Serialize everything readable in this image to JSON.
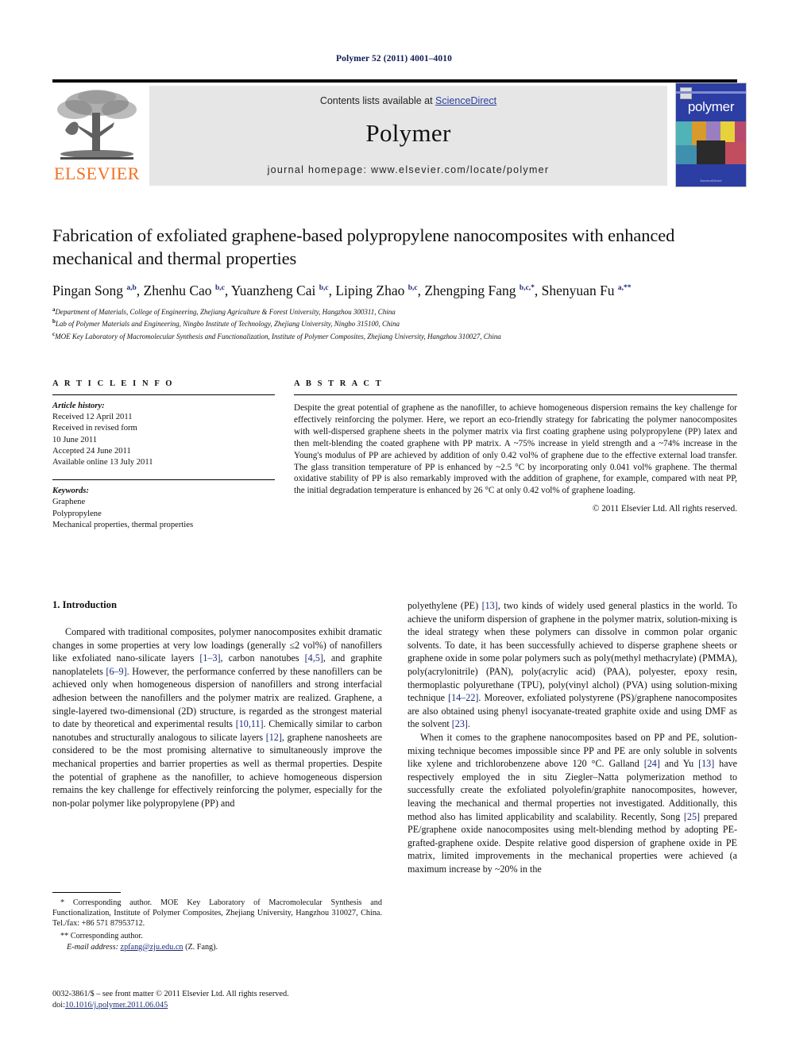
{
  "running_head": "Polymer 52 (2011) 4001–4010",
  "masthead": {
    "contents_prefix": "Contents lists available at ",
    "sciencedirect": "ScienceDirect",
    "journal_name": "Polymer",
    "homepage": "journal homepage: www.elsevier.com/locate/polymer",
    "publisher_logo_text": "ELSEVIER",
    "cover_title": "polymer",
    "cover_footer": "ScienceDirect",
    "link_color": "#2b3f9e",
    "elsevier_orange": "#f37021",
    "cover_blue": "#2c3da3"
  },
  "article": {
    "title": "Fabrication of exfoliated graphene-based polypropylene nanocomposites with enhanced mechanical and thermal properties",
    "authors_html": "Pingan Song <sup>a,b</sup>, Zhenhu Cao <sup>b,c</sup>, Yuanzheng Cai <sup>b,c</sup>, Liping Zhao <sup>b,c</sup>, Zhengping Fang <sup>b,c,</sup><sup>*</sup>, Shenyuan Fu <sup>a,</sup><sup>**</sup>",
    "affiliations": [
      {
        "marker": "a",
        "text": "Department of Materials, College of Engineering, Zhejiang Agriculture & Forest University, Hangzhou 300311, China"
      },
      {
        "marker": "b",
        "text": "Lab of Polymer Materials and Engineering, Ningbo Institute of Technology, Zhejiang University, Ningbo 315100, China"
      },
      {
        "marker": "c",
        "text": "MOE Key Laboratory of Macromolecular Synthesis and Functionalization, Institute of Polymer Composites, Zhejiang University, Hangzhou 310027, China"
      }
    ]
  },
  "article_info": {
    "heading": "A R T I C L E  I N F O",
    "history_label": "Article history:",
    "history": [
      "Received 12 April 2011",
      "Received in revised form",
      "10 June 2011",
      "Accepted 24 June 2011",
      "Available online 13 July 2011"
    ],
    "keywords_label": "Keywords:",
    "keywords": [
      "Graphene",
      "Polypropylene",
      "Mechanical properties, thermal properties"
    ]
  },
  "abstract": {
    "heading": "A B S T R A C T",
    "text": "Despite the great potential of graphene as the nanofiller, to achieve homogeneous dispersion remains the key challenge for effectively reinforcing the polymer. Here, we report an eco-friendly strategy for fabricating the polymer nanocomposites with well-dispersed graphene sheets in the polymer matrix via first coating graphene using polypropylene (PP) latex and then melt-blending the coated graphene with PP matrix. A ~75% increase in yield strength and a ~74% increase in the Young's modulus of PP are achieved by addition of only 0.42 vol% of graphene due to the effective external load transfer. The glass transition temperature of PP is enhanced by ~2.5 °C by incorporating only 0.041 vol% graphene. The thermal oxidative stability of PP is also remarkably improved with the addition of graphene, for example, compared with neat PP, the initial degradation temperature is enhanced by 26 °C at only 0.42 vol% of graphene loading.",
    "copyright": "© 2011 Elsevier Ltd. All rights reserved."
  },
  "body": {
    "section_heading": "1. Introduction",
    "left_paragraph_1_html": "Compared with traditional composites, polymer nanocomposites exhibit dramatic changes in some properties at very low loadings (generally ≤2 vol%) of nanofillers like exfoliated nano-silicate layers <span class=\"ref\">[1–3]</span>, carbon nanotubes <span class=\"ref\">[4,5]</span>, and graphite nanoplatelets <span class=\"ref\">[6–9]</span>. However, the performance conferred by these nanofillers can be achieved only when homogeneous dispersion of nanofillers and strong interfacial adhesion between the nanofillers and the polymer matrix are realized. Graphene, a single-layered two-dimensional (2D) structure, is regarded as the strongest material to date by theoretical and experimental results <span class=\"ref\">[10,11]</span>. Chemically similar to carbon nanotubes and structurally analogous to silicate layers <span class=\"ref\">[12]</span>, graphene nanosheets are considered to be the most promising alternative to simultaneously improve the mechanical properties and barrier properties as well as thermal properties. Despite the potential of graphene as the nanofiller, to achieve homogeneous dispersion remains the key challenge for effectively reinforcing the polymer, especially for the non-polar polymer like polypropylene (PP) and",
    "right_paragraph_1_html": "polyethylene (PE) <span class=\"ref\">[13]</span>, two kinds of widely used general plastics in the world. To achieve the uniform dispersion of graphene in the polymer matrix, solution-mixing is the ideal strategy when these polymers can dissolve in common polar organic solvents. To date, it has been successfully achieved to disperse graphene sheets or graphene oxide in some polar polymers such as poly(methyl methacrylate) (PMMA), poly(acrylonitrile) (PAN), poly(acrylic acid) (PAA), polyester, epoxy resin, thermoplastic polyurethane (TPU), poly(vinyl alchol) (PVA) using solution-mixing technique <span class=\"ref\">[14–22]</span>. Moreover, exfoliated polystyrene (PS)/graphene nanocomposites are also obtained using phenyl isocyanate-treated graphite oxide and using DMF as the solvent <span class=\"ref\">[23]</span>.",
    "right_paragraph_2_html": "When it comes to the graphene nanocomposites based on PP and PE, solution-mixing technique becomes impossible since PP and PE are only soluble in solvents like xylene and trichlorobenzene above 120 °C. Galland <span class=\"ref\">[24]</span> and Yu <span class=\"ref\">[13]</span> have respectively employed the in situ Ziegler–Natta polymerization method to successfully create the exfoliated polyolefin/graphite nanocomposites, however, leaving the mechanical and thermal properties not investigated. Additionally, this method also has limited applicability and scalability. Recently, Song <span class=\"ref\">[25]</span> prepared PE/graphene oxide nanocomposites using melt-blending method by adopting PE-grafted-graphene oxide. Despite relative good dispersion of graphene oxide in PE matrix, limited improvements in the mechanical properties were achieved (a maximum increase by ~20% in the"
  },
  "footnotes": {
    "first_html": "* Corresponding author. MOE Key Laboratory of Macromolecular Synthesis and Functionalization, Institute of Polymer Composites, Zhejiang University, Hangzhou 310027, China. Tel./fax: +86 571 87953712.",
    "second_html": "** Corresponding author.",
    "email_label": "E-mail address:",
    "email": "zpfang@zju.edu.cn",
    "email_suffix": "(Z. Fang)."
  },
  "imprint": {
    "line1": "0032-3861/$ – see front matter © 2011 Elsevier Ltd. All rights reserved.",
    "doi_prefix": "doi:",
    "doi": "10.1016/j.polymer.2011.06.045"
  }
}
